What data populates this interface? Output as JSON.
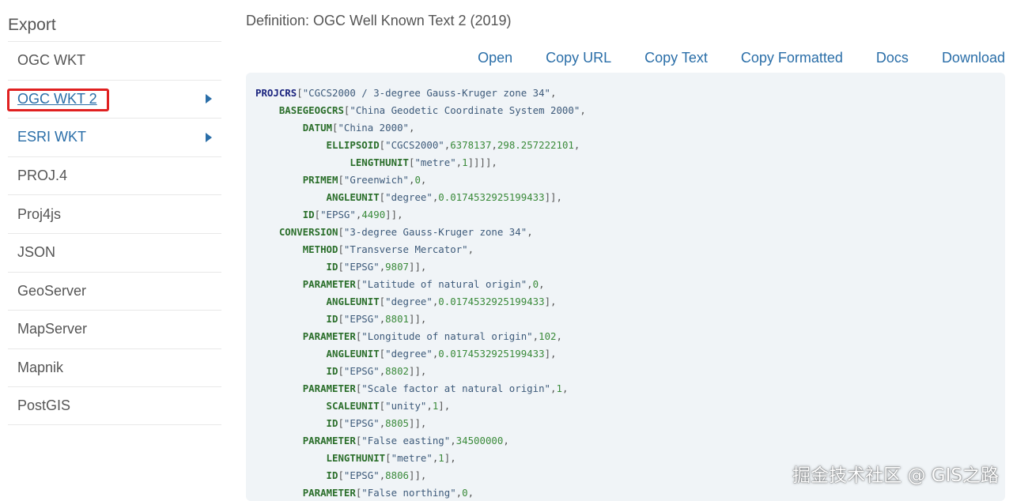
{
  "sidebar": {
    "title": "Export",
    "items": [
      {
        "label": "OGC WKT",
        "link": false,
        "arrow": false,
        "selected": false
      },
      {
        "label": "OGC WKT 2",
        "link": true,
        "arrow": true,
        "selected": true
      },
      {
        "label": "ESRI WKT",
        "link": true,
        "arrow": true,
        "selected": false
      },
      {
        "label": "PROJ.4",
        "link": false,
        "arrow": false,
        "selected": false
      },
      {
        "label": "Proj4js",
        "link": false,
        "arrow": false,
        "selected": false
      },
      {
        "label": "JSON",
        "link": false,
        "arrow": false,
        "selected": false
      },
      {
        "label": "GeoServer",
        "link": false,
        "arrow": false,
        "selected": false
      },
      {
        "label": "MapServer",
        "link": false,
        "arrow": false,
        "selected": false
      },
      {
        "label": "Mapnik",
        "link": false,
        "arrow": false,
        "selected": false
      },
      {
        "label": "PostGIS",
        "link": false,
        "arrow": false,
        "selected": false
      }
    ]
  },
  "main": {
    "definition": "Definition: OGC Well Known Text 2 (2019)",
    "actions": [
      "Open",
      "Copy URL",
      "Copy Text",
      "Copy Formatted",
      "Docs",
      "Download"
    ]
  },
  "code_lines": [
    {
      "indent": 0,
      "tokens": [
        {
          "t": "kw",
          "v": "PROJCRS"
        },
        {
          "t": "punc",
          "v": "["
        },
        {
          "t": "str",
          "v": "\"CGCS2000 / 3-degree Gauss-Kruger zone 34\""
        },
        {
          "t": "punc",
          "v": ","
        }
      ]
    },
    {
      "indent": 1,
      "tokens": [
        {
          "t": "kw2",
          "v": "BASEGEOGCRS"
        },
        {
          "t": "punc",
          "v": "["
        },
        {
          "t": "str",
          "v": "\"China Geodetic Coordinate System 2000\""
        },
        {
          "t": "punc",
          "v": ","
        }
      ]
    },
    {
      "indent": 2,
      "tokens": [
        {
          "t": "kw2",
          "v": "DATUM"
        },
        {
          "t": "punc",
          "v": "["
        },
        {
          "t": "str",
          "v": "\"China 2000\""
        },
        {
          "t": "punc",
          "v": ","
        }
      ]
    },
    {
      "indent": 3,
      "tokens": [
        {
          "t": "kw2",
          "v": "ELLIPSOID"
        },
        {
          "t": "punc",
          "v": "["
        },
        {
          "t": "str",
          "v": "\"CGCS2000\""
        },
        {
          "t": "punc",
          "v": ","
        },
        {
          "t": "num",
          "v": "6378137"
        },
        {
          "t": "punc",
          "v": ","
        },
        {
          "t": "num",
          "v": "298.257222101"
        },
        {
          "t": "punc",
          "v": ","
        }
      ]
    },
    {
      "indent": 4,
      "tokens": [
        {
          "t": "kw2",
          "v": "LENGTHUNIT"
        },
        {
          "t": "punc",
          "v": "["
        },
        {
          "t": "str",
          "v": "\"metre\""
        },
        {
          "t": "punc",
          "v": ","
        },
        {
          "t": "num",
          "v": "1"
        },
        {
          "t": "punc",
          "v": "]]]],"
        }
      ]
    },
    {
      "indent": 2,
      "tokens": [
        {
          "t": "kw2",
          "v": "PRIMEM"
        },
        {
          "t": "punc",
          "v": "["
        },
        {
          "t": "str",
          "v": "\"Greenwich\""
        },
        {
          "t": "punc",
          "v": ","
        },
        {
          "t": "num",
          "v": "0"
        },
        {
          "t": "punc",
          "v": ","
        }
      ]
    },
    {
      "indent": 3,
      "tokens": [
        {
          "t": "kw2",
          "v": "ANGLEUNIT"
        },
        {
          "t": "punc",
          "v": "["
        },
        {
          "t": "str",
          "v": "\"degree\""
        },
        {
          "t": "punc",
          "v": ","
        },
        {
          "t": "num",
          "v": "0.0174532925199433"
        },
        {
          "t": "punc",
          "v": "]],"
        }
      ]
    },
    {
      "indent": 2,
      "tokens": [
        {
          "t": "kw2",
          "v": "ID"
        },
        {
          "t": "punc",
          "v": "["
        },
        {
          "t": "str",
          "v": "\"EPSG\""
        },
        {
          "t": "punc",
          "v": ","
        },
        {
          "t": "num",
          "v": "4490"
        },
        {
          "t": "punc",
          "v": "]],"
        }
      ]
    },
    {
      "indent": 1,
      "tokens": [
        {
          "t": "kw2",
          "v": "CONVERSION"
        },
        {
          "t": "punc",
          "v": "["
        },
        {
          "t": "str",
          "v": "\"3-degree Gauss-Kruger zone 34\""
        },
        {
          "t": "punc",
          "v": ","
        }
      ]
    },
    {
      "indent": 2,
      "tokens": [
        {
          "t": "kw2",
          "v": "METHOD"
        },
        {
          "t": "punc",
          "v": "["
        },
        {
          "t": "str",
          "v": "\"Transverse Mercator\""
        },
        {
          "t": "punc",
          "v": ","
        }
      ]
    },
    {
      "indent": 3,
      "tokens": [
        {
          "t": "kw2",
          "v": "ID"
        },
        {
          "t": "punc",
          "v": "["
        },
        {
          "t": "str",
          "v": "\"EPSG\""
        },
        {
          "t": "punc",
          "v": ","
        },
        {
          "t": "num",
          "v": "9807"
        },
        {
          "t": "punc",
          "v": "]],"
        }
      ]
    },
    {
      "indent": 2,
      "tokens": [
        {
          "t": "kw2",
          "v": "PARAMETER"
        },
        {
          "t": "punc",
          "v": "["
        },
        {
          "t": "str",
          "v": "\"Latitude of natural origin\""
        },
        {
          "t": "punc",
          "v": ","
        },
        {
          "t": "num",
          "v": "0"
        },
        {
          "t": "punc",
          "v": ","
        }
      ]
    },
    {
      "indent": 3,
      "tokens": [
        {
          "t": "kw2",
          "v": "ANGLEUNIT"
        },
        {
          "t": "punc",
          "v": "["
        },
        {
          "t": "str",
          "v": "\"degree\""
        },
        {
          "t": "punc",
          "v": ","
        },
        {
          "t": "num",
          "v": "0.0174532925199433"
        },
        {
          "t": "punc",
          "v": "],"
        }
      ]
    },
    {
      "indent": 3,
      "tokens": [
        {
          "t": "kw2",
          "v": "ID"
        },
        {
          "t": "punc",
          "v": "["
        },
        {
          "t": "str",
          "v": "\"EPSG\""
        },
        {
          "t": "punc",
          "v": ","
        },
        {
          "t": "num",
          "v": "8801"
        },
        {
          "t": "punc",
          "v": "]],"
        }
      ]
    },
    {
      "indent": 2,
      "tokens": [
        {
          "t": "kw2",
          "v": "PARAMETER"
        },
        {
          "t": "punc",
          "v": "["
        },
        {
          "t": "str",
          "v": "\"Longitude of natural origin\""
        },
        {
          "t": "punc",
          "v": ","
        },
        {
          "t": "num",
          "v": "102"
        },
        {
          "t": "punc",
          "v": ","
        }
      ]
    },
    {
      "indent": 3,
      "tokens": [
        {
          "t": "kw2",
          "v": "ANGLEUNIT"
        },
        {
          "t": "punc",
          "v": "["
        },
        {
          "t": "str",
          "v": "\"degree\""
        },
        {
          "t": "punc",
          "v": ","
        },
        {
          "t": "num",
          "v": "0.0174532925199433"
        },
        {
          "t": "punc",
          "v": "],"
        }
      ]
    },
    {
      "indent": 3,
      "tokens": [
        {
          "t": "kw2",
          "v": "ID"
        },
        {
          "t": "punc",
          "v": "["
        },
        {
          "t": "str",
          "v": "\"EPSG\""
        },
        {
          "t": "punc",
          "v": ","
        },
        {
          "t": "num",
          "v": "8802"
        },
        {
          "t": "punc",
          "v": "]],"
        }
      ]
    },
    {
      "indent": 2,
      "tokens": [
        {
          "t": "kw2",
          "v": "PARAMETER"
        },
        {
          "t": "punc",
          "v": "["
        },
        {
          "t": "str",
          "v": "\"Scale factor at natural origin\""
        },
        {
          "t": "punc",
          "v": ","
        },
        {
          "t": "num",
          "v": "1"
        },
        {
          "t": "punc",
          "v": ","
        }
      ]
    },
    {
      "indent": 3,
      "tokens": [
        {
          "t": "kw2",
          "v": "SCALEUNIT"
        },
        {
          "t": "punc",
          "v": "["
        },
        {
          "t": "str",
          "v": "\"unity\""
        },
        {
          "t": "punc",
          "v": ","
        },
        {
          "t": "num",
          "v": "1"
        },
        {
          "t": "punc",
          "v": "],"
        }
      ]
    },
    {
      "indent": 3,
      "tokens": [
        {
          "t": "kw2",
          "v": "ID"
        },
        {
          "t": "punc",
          "v": "["
        },
        {
          "t": "str",
          "v": "\"EPSG\""
        },
        {
          "t": "punc",
          "v": ","
        },
        {
          "t": "num",
          "v": "8805"
        },
        {
          "t": "punc",
          "v": "]],"
        }
      ]
    },
    {
      "indent": 2,
      "tokens": [
        {
          "t": "kw2",
          "v": "PARAMETER"
        },
        {
          "t": "punc",
          "v": "["
        },
        {
          "t": "str",
          "v": "\"False easting\""
        },
        {
          "t": "punc",
          "v": ","
        },
        {
          "t": "num",
          "v": "34500000"
        },
        {
          "t": "punc",
          "v": ","
        }
      ]
    },
    {
      "indent": 3,
      "tokens": [
        {
          "t": "kw2",
          "v": "LENGTHUNIT"
        },
        {
          "t": "punc",
          "v": "["
        },
        {
          "t": "str",
          "v": "\"metre\""
        },
        {
          "t": "punc",
          "v": ","
        },
        {
          "t": "num",
          "v": "1"
        },
        {
          "t": "punc",
          "v": "],"
        }
      ]
    },
    {
      "indent": 3,
      "tokens": [
        {
          "t": "kw2",
          "v": "ID"
        },
        {
          "t": "punc",
          "v": "["
        },
        {
          "t": "str",
          "v": "\"EPSG\""
        },
        {
          "t": "punc",
          "v": ","
        },
        {
          "t": "num",
          "v": "8806"
        },
        {
          "t": "punc",
          "v": "]],"
        }
      ]
    },
    {
      "indent": 2,
      "tokens": [
        {
          "t": "kw2",
          "v": "PARAMETER"
        },
        {
          "t": "punc",
          "v": "["
        },
        {
          "t": "str",
          "v": "\"False northing\""
        },
        {
          "t": "punc",
          "v": ","
        },
        {
          "t": "num",
          "v": "0"
        },
        {
          "t": "punc",
          "v": ","
        }
      ]
    }
  ],
  "watermark": "掘金技术社区 @ GIS之路",
  "colors": {
    "link": "#2a6ea8",
    "highlight": "#e02020",
    "code_bg": "#f0f4f7",
    "keyword": "#1a237e",
    "keyword2": "#2a6e2a",
    "number": "#3a8a3a"
  }
}
